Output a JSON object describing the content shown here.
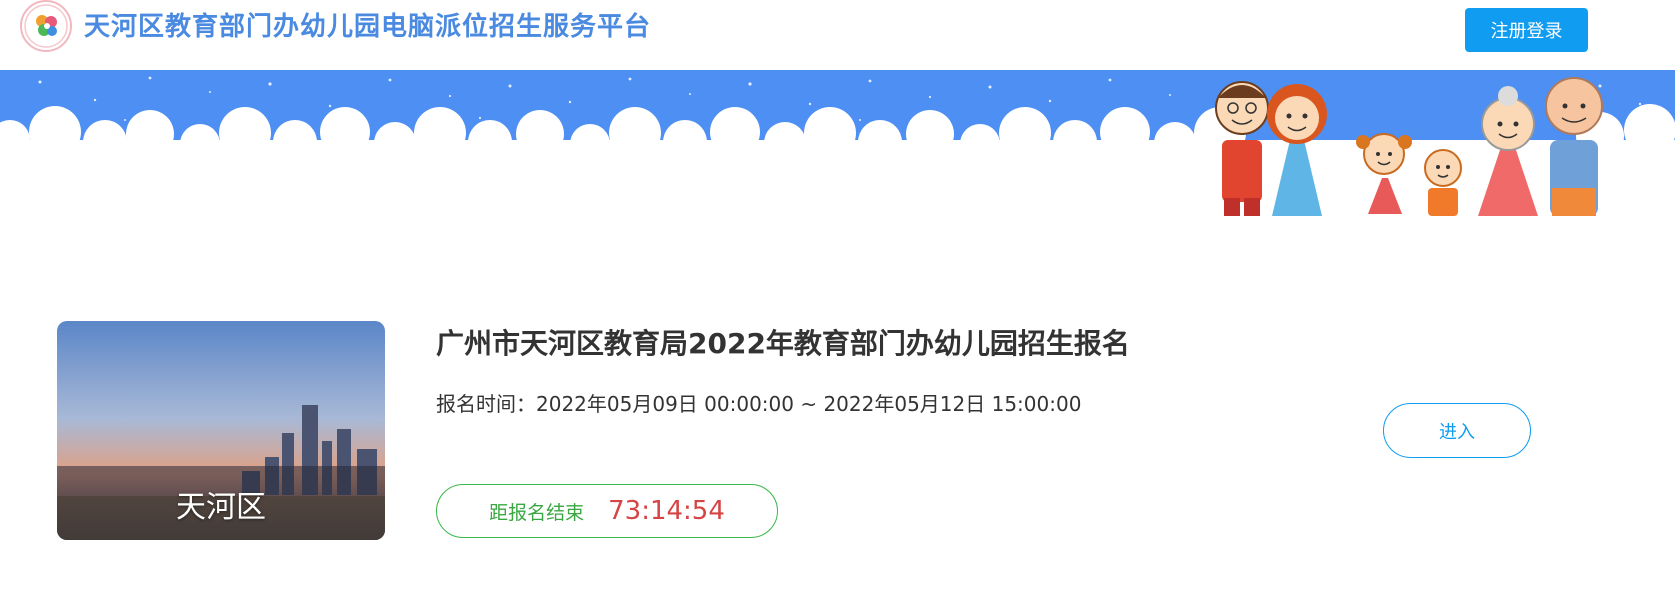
{
  "header": {
    "site_title": "天河区教育部门办幼儿园电脑派位招生服务平台",
    "login_button": "注册登录"
  },
  "colors": {
    "brand_blue": "#4a8ae0",
    "button_blue": "#109cf0",
    "banner_sky": "#4d8ff2",
    "countdown_green": "#3bb84a",
    "countdown_red": "#d64545"
  },
  "card": {
    "district": "天河区",
    "title": "广州市天河区教育局2022年教育部门办幼儿园招生报名",
    "time_text": "报名时间：2022年05月09日 00:00:00 ~ 2022年05月12日 15:00:00",
    "countdown_label": "距报名结束",
    "countdown_value": "73:14:54",
    "enter_button": "进入"
  }
}
